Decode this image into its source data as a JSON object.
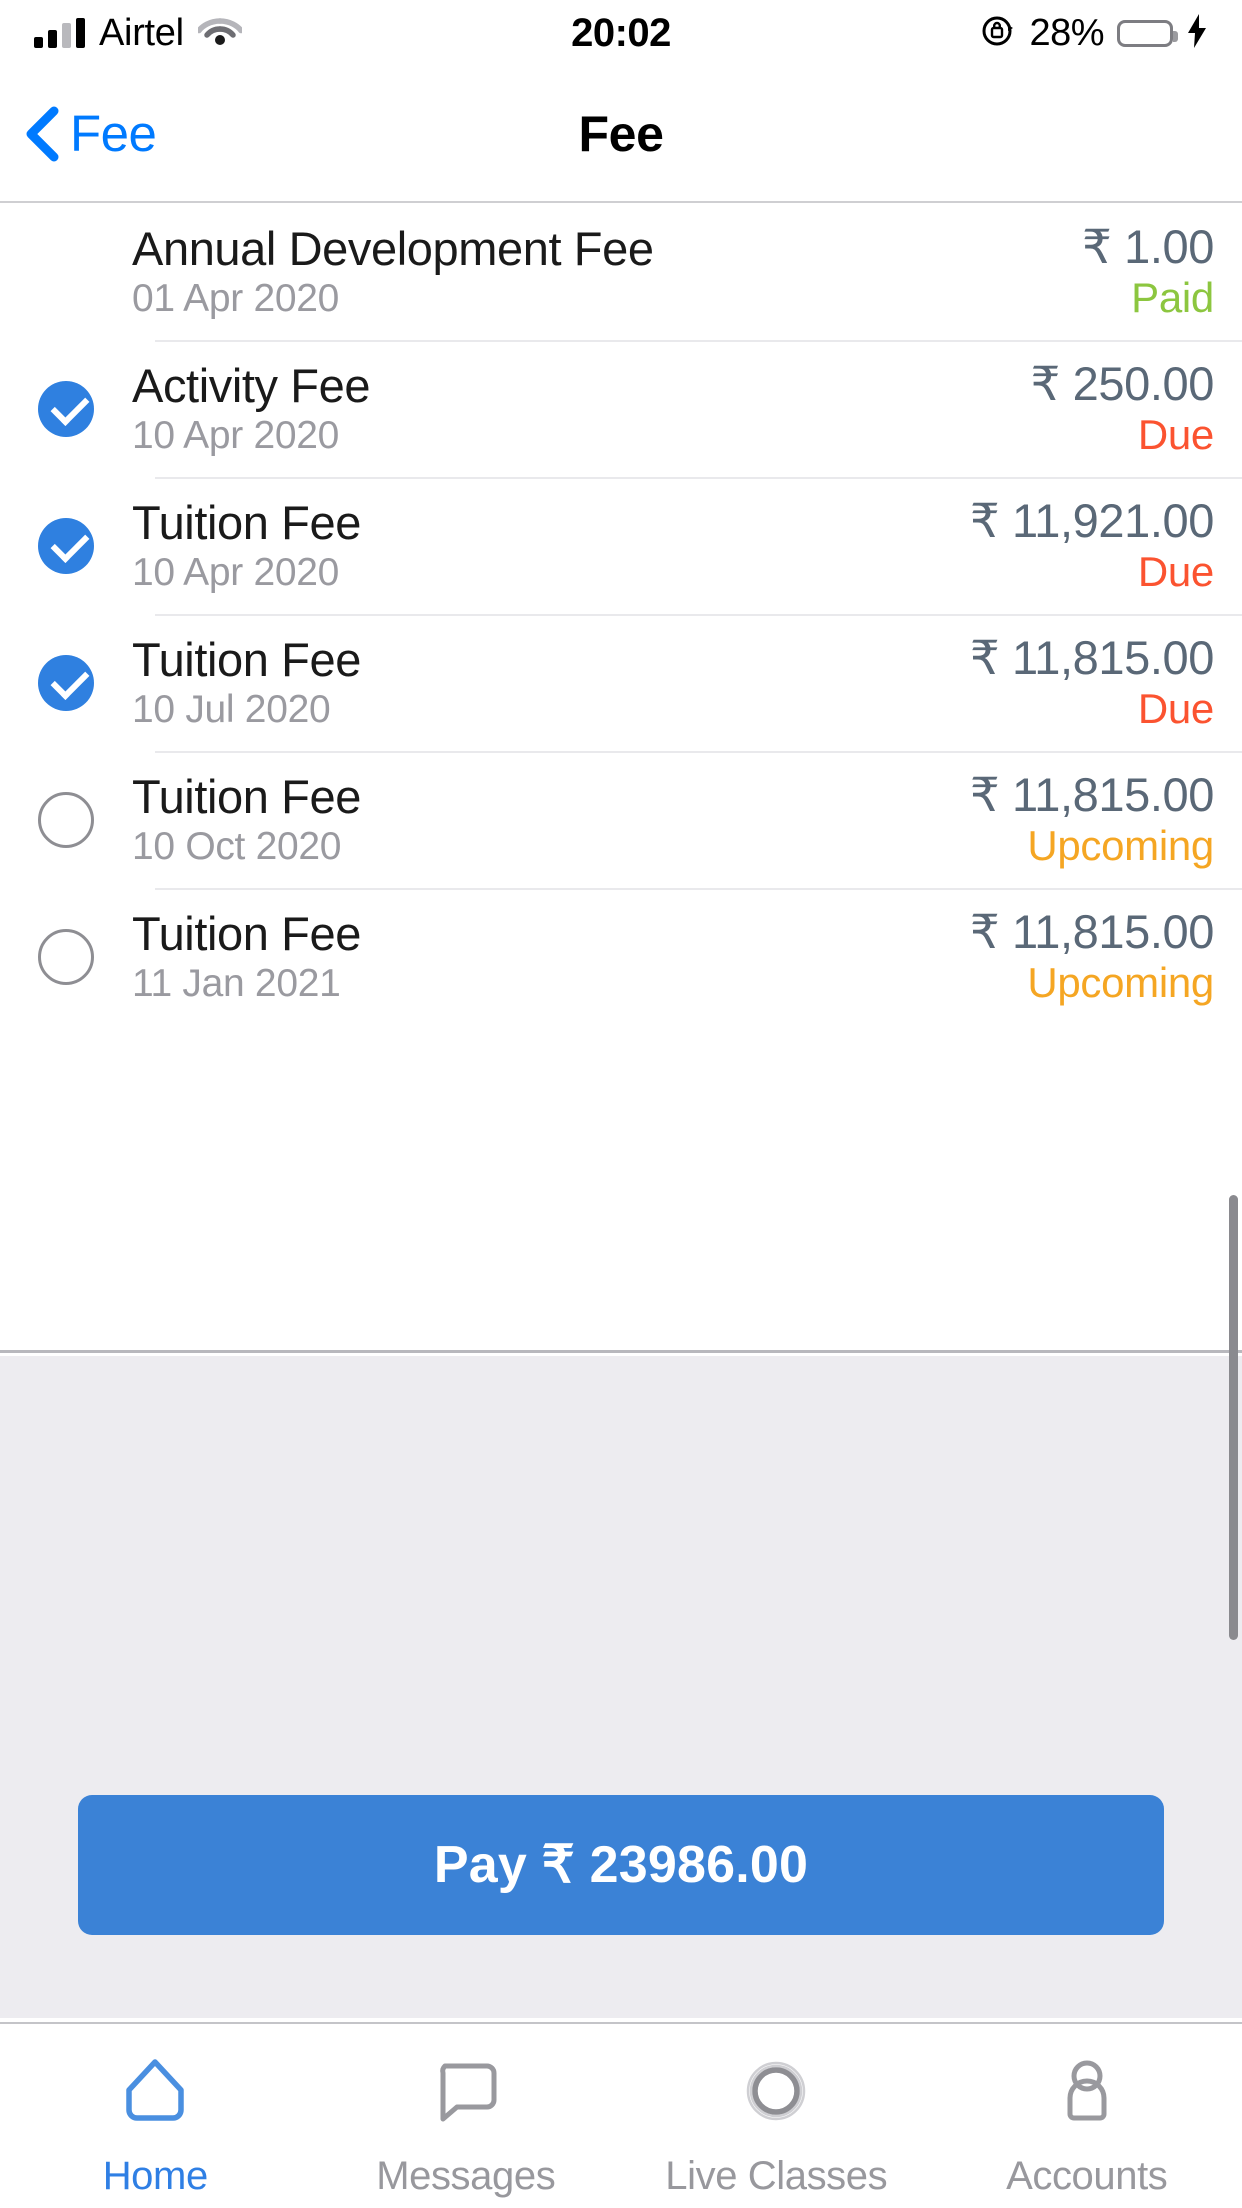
{
  "status_bar": {
    "carrier": "Airtel",
    "time": "20:02",
    "battery_percent": "28%",
    "signal_icon": "signal-bars-icon",
    "wifi_icon": "wifi-icon",
    "rotation_lock_icon": "rotation-lock-icon",
    "battery_icon": "battery-icon",
    "charging_icon": "charging-bolt-icon",
    "battery_color": "#34c759"
  },
  "nav": {
    "back_label": "Fee",
    "back_icon": "chevron-left-icon",
    "title": "Fee",
    "tint_color": "#007aff"
  },
  "fees": [
    {
      "name": "Annual Development Fee",
      "date": "01 Apr 2020",
      "amount": "₹ 1.00",
      "status": "Paid",
      "status_color": "#8cc63f",
      "checkbox": "none"
    },
    {
      "name": "Activity Fee",
      "date": "10 Apr 2020",
      "amount": "₹ 250.00",
      "status": "Due",
      "status_color": "#fb5330",
      "checkbox": "checked"
    },
    {
      "name": "Tuition Fee",
      "date": "10 Apr 2020",
      "amount": "₹ 11,921.00",
      "status": "Due",
      "status_color": "#fb5330",
      "checkbox": "checked"
    },
    {
      "name": "Tuition Fee",
      "date": "10 Jul 2020",
      "amount": "₹ 11,815.00",
      "status": "Due",
      "status_color": "#fb5330",
      "checkbox": "checked"
    },
    {
      "name": "Tuition Fee",
      "date": "10 Oct 2020",
      "amount": "₹ 11,815.00",
      "status": "Upcoming",
      "status_color": "#f5a623",
      "checkbox": "unchecked"
    },
    {
      "name": "Tuition Fee",
      "date": "11 Jan 2021",
      "amount": "₹ 11,815.00",
      "status": "Upcoming",
      "status_color": "#f5a623",
      "checkbox": "unchecked"
    }
  ],
  "pay_button": {
    "label": "Pay  ₹ 23986.00",
    "color": "#3b82d6"
  },
  "scrollbar": {
    "name": "vertical-scrollbar"
  },
  "tabbar": {
    "active_color": "#2f7fe4",
    "inactive_color": "#98989d",
    "items": [
      {
        "label": "Home",
        "icon": "home-icon",
        "active": true
      },
      {
        "label": "Messages",
        "icon": "message-bubble-icon",
        "active": false
      },
      {
        "label": "Live Classes",
        "icon": "broadcast-rings-icon",
        "active": false
      },
      {
        "label": "Accounts",
        "icon": "person-icon",
        "active": false
      }
    ]
  }
}
